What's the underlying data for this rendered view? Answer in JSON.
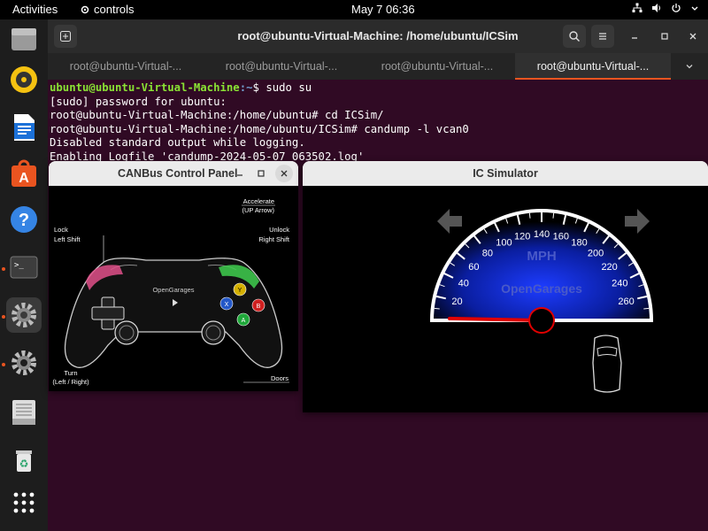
{
  "topbar": {
    "activities": "Activities",
    "app_name": "controls",
    "clock": "May 7  06:36"
  },
  "dock": {
    "items": [
      "files-icon",
      "rhythmbox-icon",
      "writer-icon",
      "software-icon",
      "help-icon",
      "terminal-icon",
      "settings-icon",
      "settings-icon-2",
      "disk-icon",
      "trash-icon",
      "app-grid-icon"
    ]
  },
  "terminal": {
    "title": "root@ubuntu-Virtual-Machine: /home/ubuntu/ICSim",
    "tabs": [
      {
        "label": "root@ubuntu-Virtual-..."
      },
      {
        "label": "root@ubuntu-Virtual-..."
      },
      {
        "label": "root@ubuntu-Virtual-..."
      },
      {
        "label": "root@ubuntu-Virtual-..."
      }
    ],
    "lines": {
      "l1_user": "ubuntu@ubuntu-Virtual-Machine",
      "l1_path": ":~",
      "l1_cmd": "$ sudo su",
      "l2": "[sudo] password for ubuntu:",
      "l3": "root@ubuntu-Virtual-Machine:/home/ubuntu# cd ICSim/",
      "l4": "root@ubuntu-Virtual-Machine:/home/ubuntu/ICSim# candump -l vcan0",
      "l5": "Disabled standard output while logging.",
      "l6": "Enabling Logfile 'candump-2024-05-07_063502.log'"
    }
  },
  "control_panel": {
    "title": "CANBus Control Panel",
    "accelerate": "Accelerate",
    "up_arrow": "(UP Arrow)",
    "lock": "Lock",
    "left_shift": "Left Shift",
    "unlock": "Unlock",
    "right_shift": "Right Shift",
    "brand": "OpenGarages",
    "turn": "Turn",
    "turn_keys": "(Left / Right)",
    "doors": "Doors",
    "btn_y": "Y",
    "btn_x": "X",
    "btn_b": "B",
    "btn_a": "A"
  },
  "ic_simulator": {
    "title": "IC Simulator",
    "unit": "MPH",
    "brand": "OpenGarages",
    "speed": 0,
    "ticks": [
      "20",
      "40",
      "60",
      "80",
      "100",
      "120",
      "140",
      "160",
      "180",
      "200",
      "220",
      "240",
      "260"
    ]
  }
}
